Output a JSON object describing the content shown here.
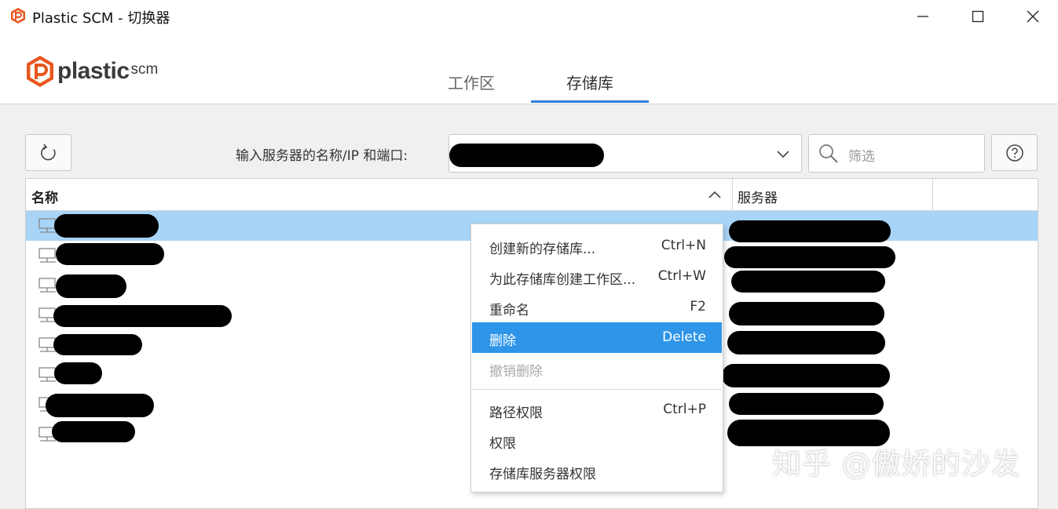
{
  "window": {
    "title": "Plastic SCM - 切换器",
    "minimize": "minimize",
    "maximize": "maximize",
    "close": "close"
  },
  "logo": {
    "text": "plastic",
    "sub": "scm"
  },
  "tabs": [
    {
      "label": "工作区",
      "active": false
    },
    {
      "label": "存储库",
      "active": true
    }
  ],
  "toolbar": {
    "refresh_icon": "refresh-icon",
    "server_label": "输入服务器的名称/IP 和端口:",
    "filter_placeholder": "筛选",
    "help_icon": "help-icon"
  },
  "table": {
    "columns": [
      "名称",
      "服务器"
    ],
    "row_count": 8,
    "selected_row": 0
  },
  "context_menu": {
    "items": [
      {
        "label": "创建新的存储库...",
        "shortcut": "Ctrl+N",
        "state": "normal"
      },
      {
        "label": "为此存储库创建工作区...",
        "shortcut": "Ctrl+W",
        "state": "normal"
      },
      {
        "label": "重命名",
        "shortcut": "F2",
        "state": "normal"
      },
      {
        "label": "删除",
        "shortcut": "Delete",
        "state": "highlighted"
      },
      {
        "label": "撤销删除",
        "shortcut": "",
        "state": "disabled"
      },
      {
        "label": "路径权限",
        "shortcut": "Ctrl+P",
        "state": "normal"
      },
      {
        "label": "权限",
        "shortcut": "",
        "state": "normal"
      },
      {
        "label": "存储库服务器权限",
        "shortcut": "",
        "state": "normal"
      }
    ]
  },
  "watermark": "知乎 @傲娇的沙发",
  "colors": {
    "accent": "#2e7fd6",
    "highlight": "#2e95e8",
    "selected_row": "#a8d4f7",
    "logo_orange": "#e8571f"
  }
}
